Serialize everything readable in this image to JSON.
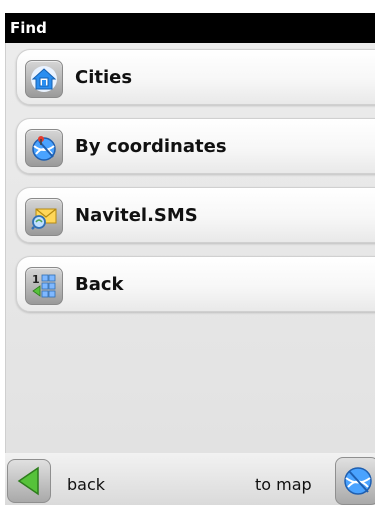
{
  "window": {
    "title": "Find"
  },
  "menu": {
    "items": [
      {
        "label": "Cities",
        "icon": "house-icon"
      },
      {
        "label": "By coordinates",
        "icon": "globe-pin-icon"
      },
      {
        "label": "Navitel.SMS",
        "icon": "envelope-search-icon"
      },
      {
        "label": "Back",
        "icon": "numbered-list-back-icon"
      }
    ]
  },
  "bottombar": {
    "back_label": "back",
    "map_label": "to map",
    "back_icon": "arrow-left-icon",
    "map_icon": "globe-icon"
  },
  "colors": {
    "title_bg": "#000000",
    "title_text": "#ffffff",
    "accent_blue": "#2a8ef0",
    "back_arrow": "#56c23a"
  }
}
